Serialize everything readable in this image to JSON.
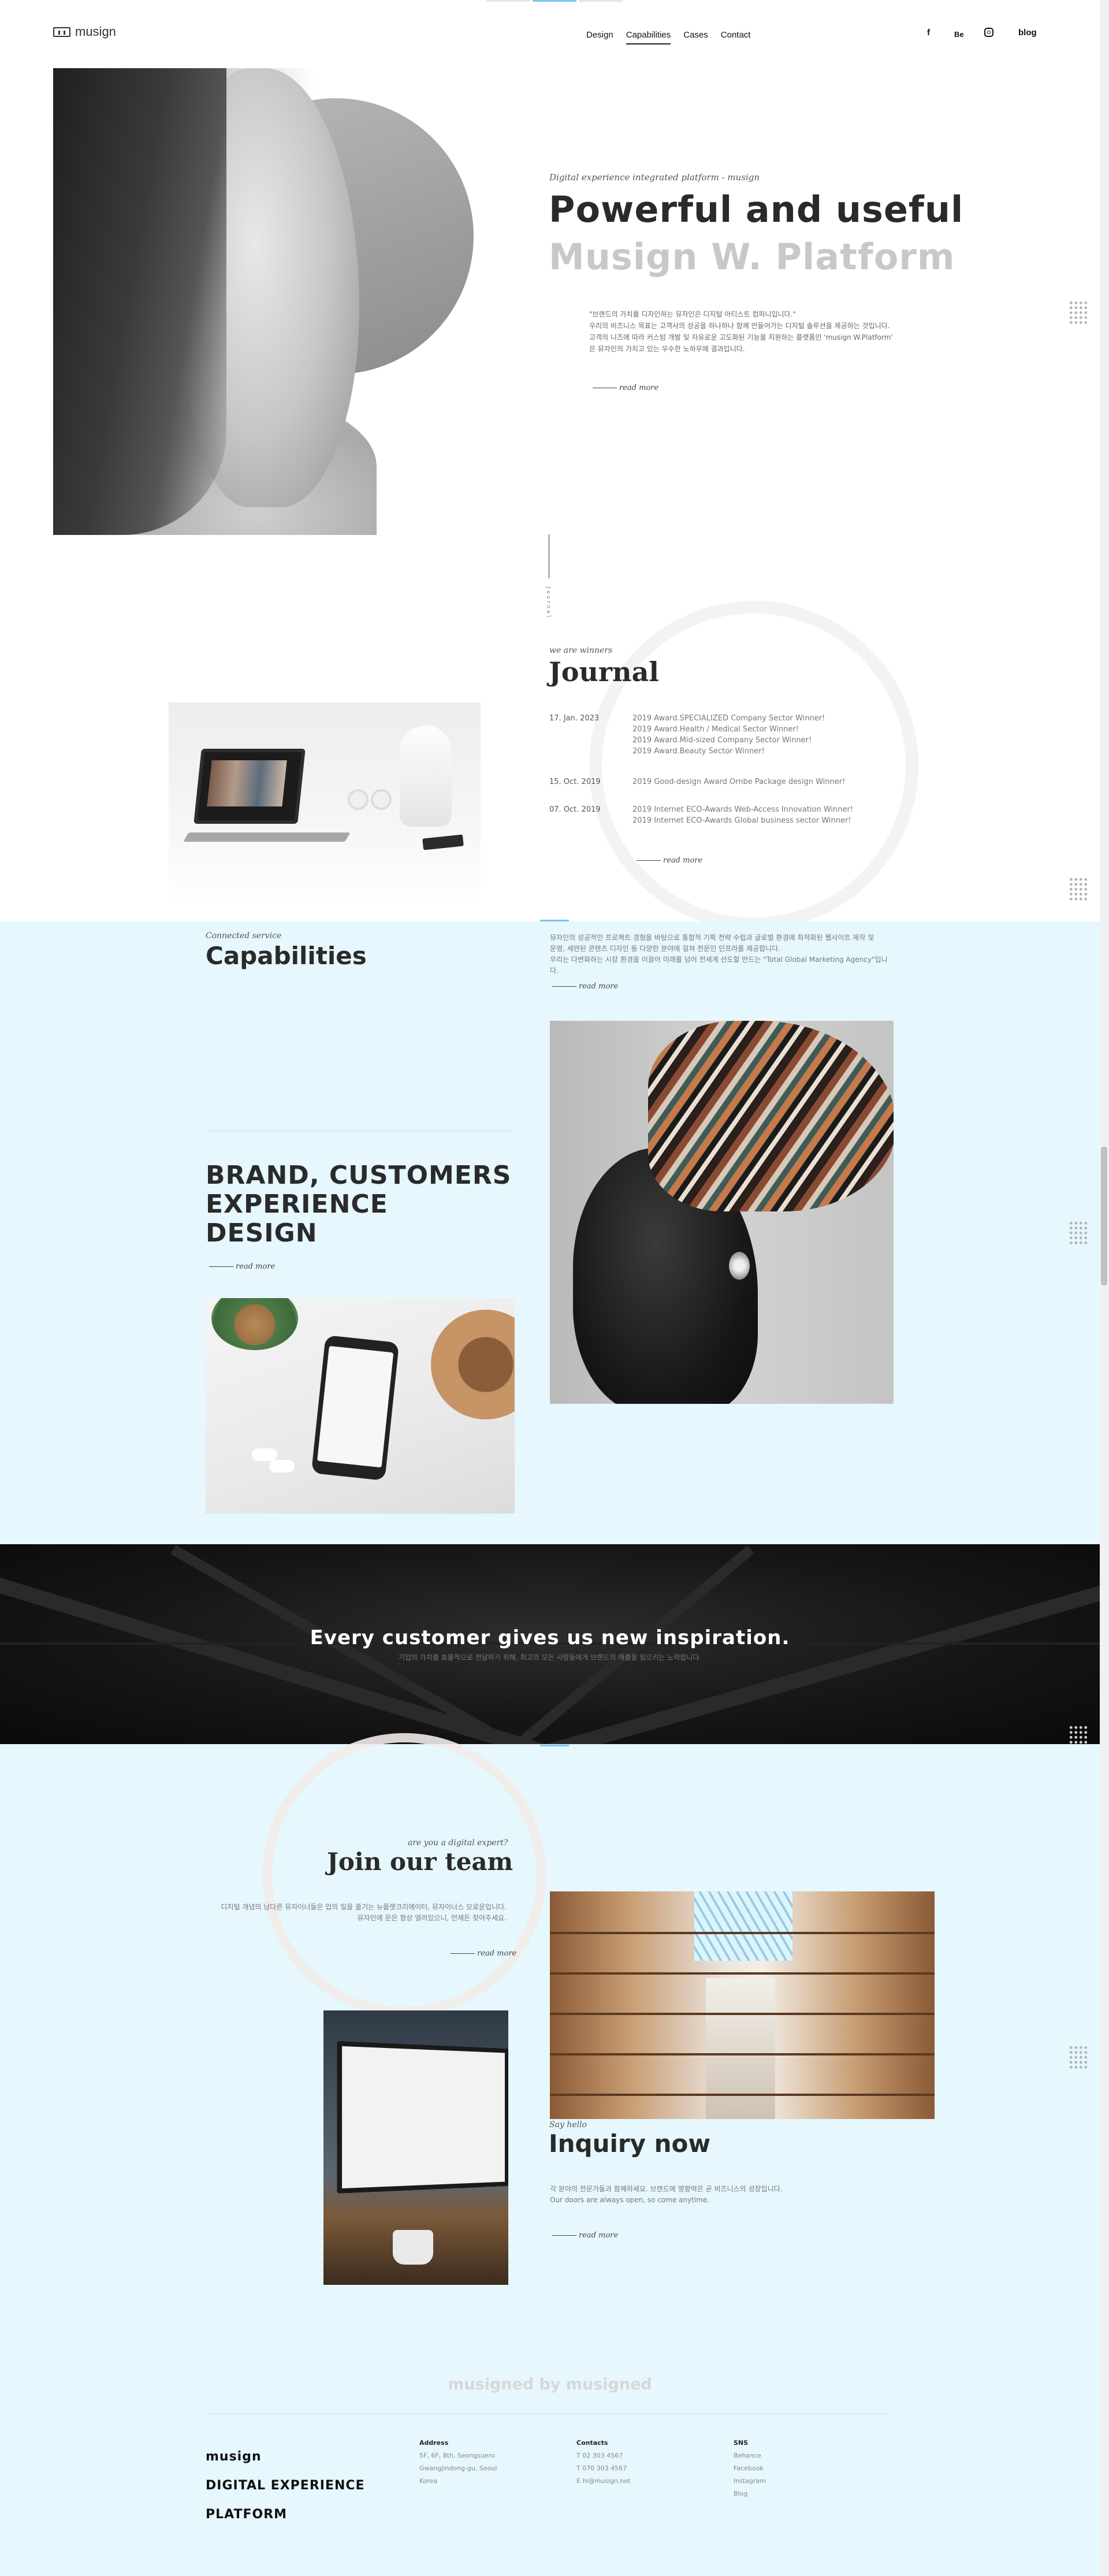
{
  "header": {
    "logo": "musign",
    "nav": [
      "Design",
      "Capabilities",
      "Cases",
      "Contact"
    ],
    "social": [
      "f",
      "Be",
      "blog"
    ],
    "instagram_icon": "instagram-icon"
  },
  "hero": {
    "kicker": "Digital experience integrated platform - musign",
    "title_line1": "Powerful and useful",
    "title_line2": "Musign W. Platform",
    "text": [
      "\"브랜드의 가치를 디자인하는 뮤자인은 디지털 아티스트 컴퍼니입니다.\"",
      "우리의 비즈니스 목표는 고객사의 성공을 하나하나 함께 만들어가는 디지털 솔루션을 제공하는 것입니다.",
      "고객의 니즈에 따라 커스텀 개발 및 자유로운 고도화된 기능을 지원하는 플랫폼인 'musign W.Platform'",
      "은 뮤자인의 가치고 있는 우수한 노하우에 결과입니다."
    ],
    "readmore": "read more"
  },
  "journal": {
    "vertical_label": "journal",
    "kicker": "we are winners",
    "title": "Journal",
    "entries": [
      {
        "date": "17. Jan. 2023",
        "items": [
          "2019 Award.SPECIALIZED Company Sector Winner!",
          "2019 Award.Health / Medical Sector Winner!",
          "2019 Award.Mid-sized Company Sector Winner!",
          "2019 Award.Beauty Sector Winner!"
        ]
      },
      {
        "date": "15. Oct. 2019",
        "items": [
          "2019 Good-design Award Ornbe Package design Winner!"
        ]
      },
      {
        "date": "07. Oct. 2019",
        "items": [
          "2019 Internet ECO-Awards Web-Access Innovation Winner!",
          "2019 Internet ECO-Awards Global business sector Winner!"
        ]
      }
    ],
    "readmore": "read more"
  },
  "capabilities": {
    "kicker": "Connected service",
    "title": "Capabilities",
    "text": [
      "뮤자인의 성공적인 프로젝트 경험을 바탕으로 통합적 기획 전략 수립과 글로벌 환경에 최적화된 웹사이트 제작 및",
      "운영, 세련된 콘텐츠 디자인 등 다양한 분야에 걸쳐 전문인 인프라를 제공합니다.",
      "우리는 다변화하는 시장 환경을 이끌어 미래를 넘어 전세계 선도할 만드는 \"Total Global Marketing Agency\"입니다."
    ],
    "readmore": "read more",
    "big_heading": [
      "BRAND, CUSTOMERS",
      "EXPERIENCE",
      "DESIGN"
    ],
    "readmore2": "read more"
  },
  "banner": {
    "title": "Every customer gives us new inspiration.",
    "subtitle": "기업의 가치를 효율적으로 전달하기 위해, 최고의 모든 사람들에게 브랜드의 매출을 일으키는 노력합니다."
  },
  "join": {
    "kicker": "are you a digital expert?",
    "title": "Join our team",
    "text": [
      "디지털 개념의 남다른 뮤자이너들은 업의 일을 즐기는 뉴플랫크리에이터, 뮤자이너스 모로운입니다.",
      "뮤자인에 문은 항상 열려있으니, 언제든 찾아주세요."
    ],
    "readmore": "read more"
  },
  "inquiry": {
    "kicker": "Say hello",
    "title": "Inquiry now",
    "text": [
      "각 분야의 전문가들과 함께하세요. 브랜드에 영향력은 곧 비즈니스의 성장입니다.",
      "Our doors are always open, so come anytime."
    ],
    "readmore": "read more"
  },
  "footer": {
    "watermark": "musigned by musigned",
    "brand": [
      "musign",
      "DIGITAL EXPERIENCE",
      "PLATFORM"
    ],
    "address": {
      "title": "Address",
      "lines": [
        "5F, 6F, 8th, Seongsuero",
        "Gwangjindong-gu, Seoul",
        "Korea"
      ]
    },
    "contacts": {
      "title": "Contacts",
      "lines": [
        "T 02 303 4567",
        "T 070 303 4567",
        "E hi@musign.net"
      ]
    },
    "sns": {
      "title": "SNS",
      "lines": [
        "Behance",
        "Facebook",
        "Instagram",
        "Blog"
      ]
    }
  }
}
